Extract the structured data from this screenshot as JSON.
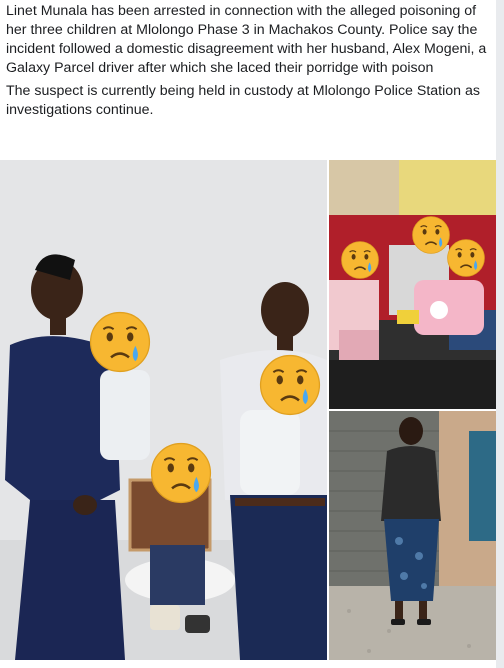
{
  "post": {
    "paragraphs": [
      "Linet Munala has been arrested in connection with the alleged poisoning of her three children at Mlolongo Phase 3 in Machakos County. Police say the incident followed a domestic disagreement with her husband, Alex Mogeni, a Galaxy Parcel driver after which she laced their porridge with poison",
      "The suspect is currently being held in custody at Mlolongo Police Station as investigations continue."
    ]
  },
  "photos": {
    "count": 3,
    "emoji_overlay": "crying-face-icon"
  },
  "colors": {
    "text": "#1c1e21",
    "emoji_face": "#f7b731",
    "tear": "#4aa8f0"
  }
}
